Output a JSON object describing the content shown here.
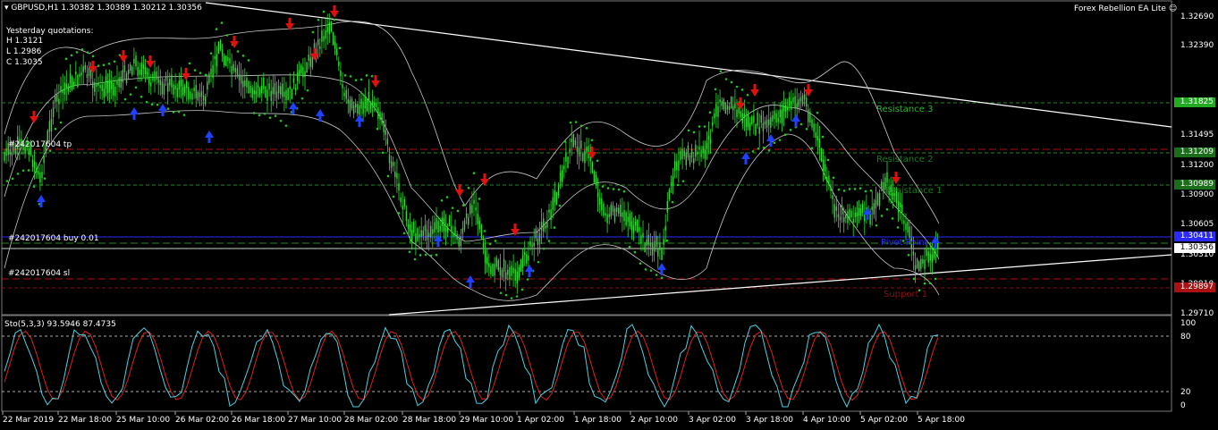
{
  "header": {
    "symbol_line": "GBPUSD,H1  1.30382 1.30389 1.30212 1.30356",
    "ea_name": "Forex Rebellion EA Lite"
  },
  "yesterday": {
    "title": "Yesterday quotations:",
    "high": "H 1.3121",
    "low": "L 1.2986",
    "close": "C 1.3035"
  },
  "order_labels": {
    "tp": "#242017604 tp",
    "buy": "#242017604 buy 0.01",
    "sl": "#242017604 sl"
  },
  "levels": {
    "resistance3": "Resistance 3",
    "resistance2": "Resistance 2",
    "resistance1": "Resistance 1",
    "pivot": "Pivot Point",
    "support1": "Support 1"
  },
  "price_axis": {
    "ticks": [
      "1.32690",
      "1.32390",
      "1.31495",
      "1.31200",
      "1.30900",
      "1.30605",
      "1.30310",
      "1.29910",
      "1.29710"
    ],
    "tags": [
      {
        "value": "1.31825",
        "color": "#22aa22"
      },
      {
        "value": "1.31209",
        "color": "#1a6e1a"
      },
      {
        "value": "1.30989",
        "color": "#1a6e1a"
      },
      {
        "value": "1.30411",
        "color": "#2a2aff"
      },
      {
        "value": "1.30356",
        "color": "#ffffff"
      },
      {
        "value": "1.29897",
        "color": "#aa1111"
      }
    ]
  },
  "stoch": {
    "label": "Sto(5,3,3) 93.5946 87.4735",
    "ticks": [
      "100",
      "80",
      "20",
      "0"
    ],
    "main_color": "#4fd0e0",
    "signal_color": "#e02020"
  },
  "time_axis": [
    "22 Mar 2019",
    "22 Mar 18:00",
    "25 Mar 10:00",
    "26 Mar 02:00",
    "26 Mar 18:00",
    "27 Mar 10:00",
    "28 Mar 02:00",
    "28 Mar 18:00",
    "29 Mar 10:00",
    "1 Apr 02:00",
    "1 Apr 18:00",
    "2 Apr 10:00",
    "3 Apr 02:00",
    "3 Apr 18:00",
    "4 Apr 10:00",
    "5 Apr 02:00",
    "5 Apr 18:00"
  ],
  "colors": {
    "candle": "#2de02d",
    "sar": "#1ec81e",
    "bands": "#c8c8c8",
    "trendline": "#ffffff",
    "down_arrow": "#e01010",
    "up_arrow": "#2040ff"
  }
}
